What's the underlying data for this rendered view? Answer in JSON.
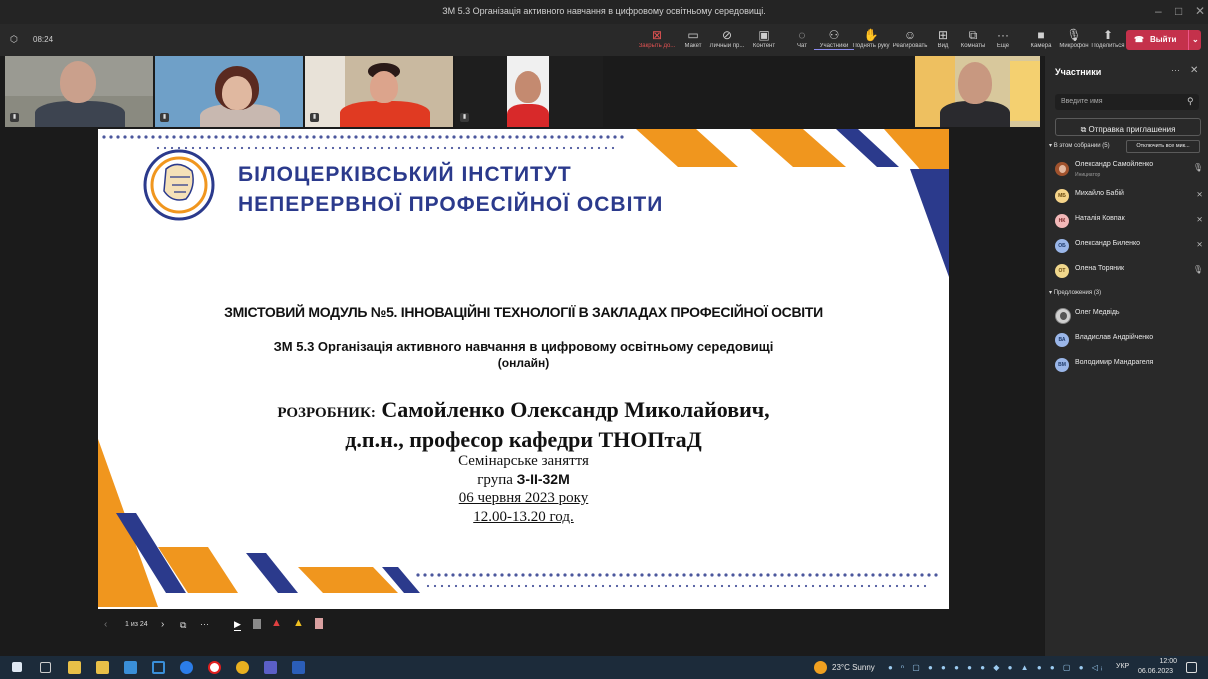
{
  "window": {
    "title": "ЗМ 5.3 Організація активного навчання в цифровому освітньому середовищі."
  },
  "meeting": {
    "timer": "08:24"
  },
  "toolbar": {
    "buttons": [
      {
        "label": "Закрыть до...",
        "icon": "close-share-icon"
      },
      {
        "label": "Макет",
        "icon": "layout-icon"
      },
      {
        "label": "Личный пр...",
        "icon": "private-view-icon"
      },
      {
        "label": "Контент",
        "icon": "content-icon"
      },
      {
        "label": "Чат",
        "icon": "chat-icon"
      },
      {
        "label": "Участники",
        "icon": "participants-icon"
      },
      {
        "label": "Поднять руку",
        "icon": "raise-hand-icon"
      },
      {
        "label": "Реагировать",
        "icon": "react-icon"
      },
      {
        "label": "Вид",
        "icon": "view-icon"
      },
      {
        "label": "Комнаты",
        "icon": "rooms-icon"
      },
      {
        "label": "Еще",
        "icon": "more-icon"
      },
      {
        "label": "Камера",
        "icon": "camera-icon"
      },
      {
        "label": "Микрофон",
        "icon": "microphone-icon"
      },
      {
        "label": "Поделиться",
        "icon": "share-icon"
      }
    ],
    "leave_label": "Выйти"
  },
  "slide": {
    "institute_line1": "БІЛОЦЕРКІВСЬКИЙ ІНСТИТУТ",
    "institute_line2": "НЕПЕРЕРВНОЇ ПРОФЕСІЙНОЇ ОСВІТИ",
    "module": "ЗМІСТОВИЙ МОДУЛЬ №5. ІННОВАЦІЙНІ ТЕХНОЛОГІЇ В ЗАКЛАДАХ ПРОФЕСІЙНОЇ ОСВІТИ",
    "topic": "ЗМ 5.3 Організація активного навчання в цифровому освітньому середовищі",
    "mode": "(онлайн)",
    "developer_label": "РОЗРОБНИК:",
    "developer_name": "Самойленко Олександр Миколайович,",
    "developer_title": "д.п.н., професор кафедри ТНОПтаД",
    "session": "Семінарське заняття",
    "group_label": "група",
    "group": "З-ІІ-32М",
    "date": "06 червня 2023  року",
    "time": "12.00-13.20 год.",
    "colors": {
      "blue": "#2b3a8c",
      "orange": "#f0961e"
    }
  },
  "slide_controls": {
    "page": "1 из 24"
  },
  "panel": {
    "title": "Участники",
    "search_placeholder": "Введите имя",
    "invite_label": "Отправка приглашения",
    "in_meeting_header": "В этом собрании (5)",
    "mute_all_label": "Отключить все мик...",
    "in_meeting": [
      {
        "name": "Олександр Самойленко",
        "role": "Инициатор",
        "initials": "",
        "color": "#a0522d"
      },
      {
        "name": "Михайло Бабій",
        "role": "",
        "initials": "МБ",
        "color": "#f5d48a"
      },
      {
        "name": "Наталія Ковпак",
        "role": "",
        "initials": "НК",
        "color": "#f2b8b8"
      },
      {
        "name": "Олександр Биленко",
        "role": "",
        "initials": "ОБ",
        "color": "#9ab6e8"
      },
      {
        "name": "Олена Торяник",
        "role": "",
        "initials": "ОТ",
        "color": "#f0d78c"
      }
    ],
    "suggested_header": "Предложения (3)",
    "suggested": [
      {
        "name": "Олег Медвідь",
        "initials": "",
        "color": "#cfcfcf"
      },
      {
        "name": "Владислав Андрійченко",
        "initials": "ВА",
        "color": "#9ab6e8"
      },
      {
        "name": "Володимир Мандрагеля",
        "initials": "ВМ",
        "color": "#9ab6e8"
      }
    ]
  },
  "taskbar": {
    "weather": "23°C  Sunny",
    "language": "УКР",
    "time": "12:00",
    "date": "06.06.2023"
  }
}
